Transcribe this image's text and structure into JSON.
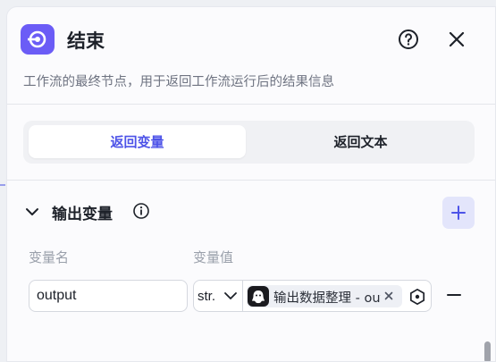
{
  "header": {
    "title": "结束",
    "description": "工作流的最终节点，用于返回工作流运行后的结果信息",
    "icons": {
      "app": "node-end-icon",
      "help": "help-circle-icon",
      "close": "close-icon"
    }
  },
  "tabs": [
    {
      "label": "返回变量",
      "active": true
    },
    {
      "label": "返回文本",
      "active": false
    }
  ],
  "output_section": {
    "title": "输出变量",
    "columns": {
      "name": "变量名",
      "value": "变量值"
    },
    "rows": [
      {
        "name": "output",
        "type": "str.",
        "reference": "输出数据整理 - output"
      }
    ]
  },
  "colors": {
    "accent": "#4d53e8",
    "icon_bg": "#6b5cf6",
    "add_bg": "#e3e5fb"
  }
}
